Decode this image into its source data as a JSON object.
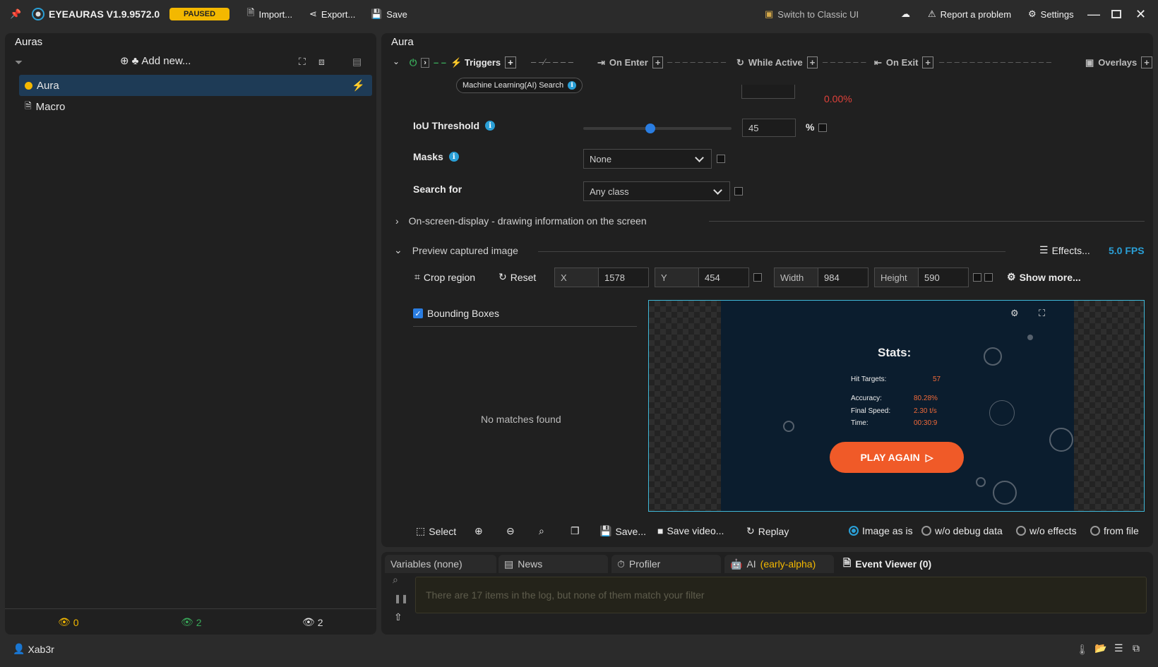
{
  "titlebar": {
    "app_title": "EYEAURAS V1.9.9572.0",
    "status_badge": "PAUSED",
    "import_label": "Import...",
    "export_label": "Export...",
    "save_label": "Save",
    "switch_label": "Switch to Classic UI",
    "report_label": "Report a problem",
    "settings_label": "Settings"
  },
  "left": {
    "title": "Auras",
    "add_new": "Add new...",
    "items": [
      {
        "label": "Aura"
      },
      {
        "label": "Macro"
      }
    ],
    "footer": {
      "hidden_count": "0",
      "visible_count": "2",
      "total_count": "2"
    }
  },
  "right": {
    "title": "Aura",
    "steps": {
      "triggers": "Triggers",
      "on_enter": "On Enter",
      "while_active": "While Active",
      "on_exit": "On Exit",
      "overlays": "Overlays"
    },
    "trigger_chip": "Machine Learning(AI) Search",
    "percent_value": "0.00%",
    "iou": {
      "label": "IoU Threshold",
      "value": "45",
      "unit": "%",
      "slider_fraction": 0.45
    },
    "masks": {
      "label": "Masks",
      "value": "None"
    },
    "search_for": {
      "label": "Search for",
      "value": "Any class"
    },
    "osd_section": "On-screen-display - drawing information on the screen",
    "preview_section": "Preview captured image",
    "effects_label": "Effects...",
    "fps": "5.0 FPS",
    "crop_label": "Crop region",
    "reset_label": "Reset",
    "fields": {
      "x_label": "X",
      "x_value": "1578",
      "y_label": "Y",
      "y_value": "454",
      "w_label": "Width",
      "w_value": "984",
      "h_label": "Height",
      "h_value": "590"
    },
    "show_more": "Show more...",
    "bbox_label": "Bounding Boxes",
    "no_matches": "No matches found",
    "game": {
      "title": "Stats:",
      "rows": [
        {
          "k": "Hit Targets:",
          "v": "57"
        },
        {
          "k": "Accuracy:",
          "v": "80.28%"
        },
        {
          "k": "Final Speed:",
          "v": "2.30 t/s"
        },
        {
          "k": "Time:",
          "v": "00:30:9"
        }
      ],
      "button": "PLAY AGAIN"
    },
    "toolbar": {
      "select": "Select",
      "save": "Save...",
      "save_video": "Save video...",
      "replay": "Replay",
      "opt1": "Image as is",
      "opt2": "w/o debug data",
      "opt3": "w/o effects",
      "opt4": "from file"
    }
  },
  "bottom": {
    "tabs": {
      "variables": "Variables (none)",
      "news": "News",
      "profiler": "Profiler",
      "ai": "AI",
      "ai_tag": "(early-alpha)",
      "event_viewer": "Event Viewer (0)"
    },
    "log_placeholder": "There are 17 items in the log, but none of them match your filter"
  },
  "status": {
    "user": "Xab3r"
  },
  "colors": {
    "accent": "#2a9fd6",
    "paused": "#f3b800",
    "play_button": "#f05a28",
    "error_red": "#e0413a"
  }
}
